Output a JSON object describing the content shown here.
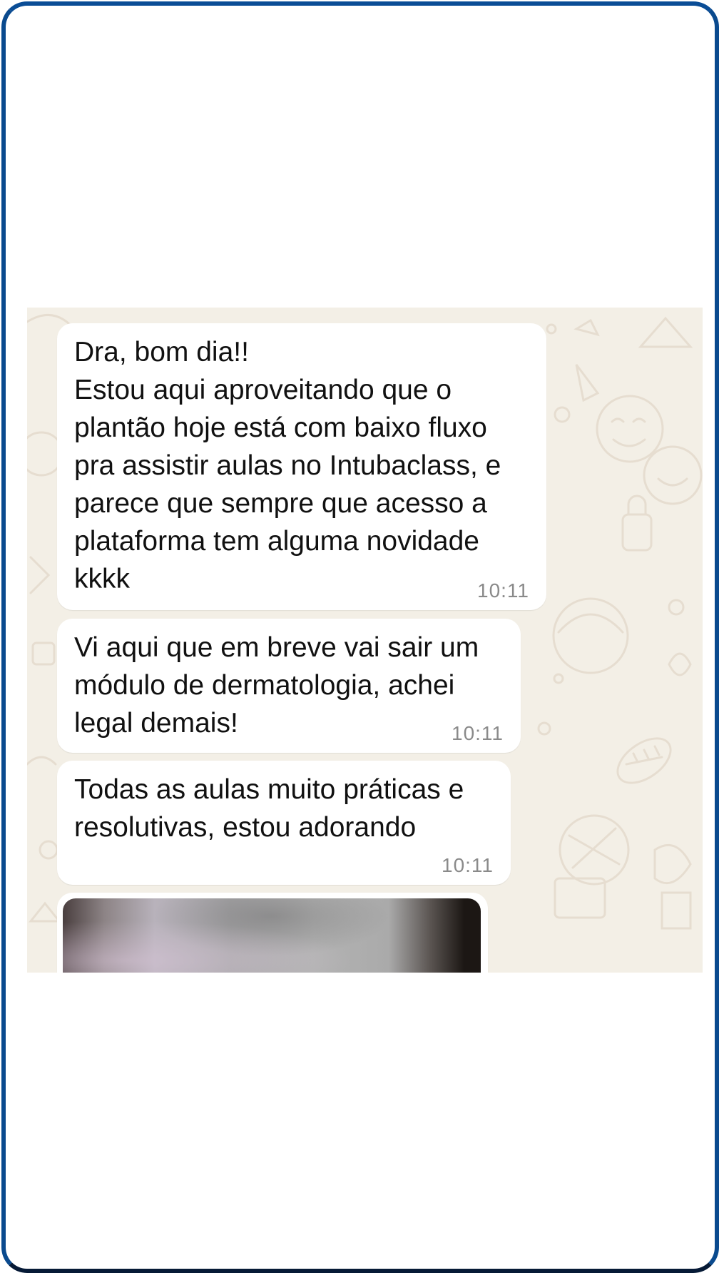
{
  "chat": {
    "messages": [
      {
        "text": "Dra, bom dia!!\nEstou aqui aproveitando que o plantão hoje está com baixo fluxo pra assistir aulas no Intubaclass, e parece que sempre que acesso a plataforma tem alguma novidade kkkk",
        "time": "10:11"
      },
      {
        "text": "Vi aqui que em breve vai sair um módulo de dermatologia, achei legal demais!",
        "time": "10:11"
      },
      {
        "text": "Todas as aulas muito práticas e resolutivas, estou adorando",
        "time": "10:11"
      }
    ],
    "media_message": {
      "type": "blurred-image"
    }
  },
  "colors": {
    "frame_border": "#0a4a8e",
    "chat_background": "#f3efe6",
    "bubble_background": "#ffffff",
    "timestamp": "#8a8a8a"
  }
}
